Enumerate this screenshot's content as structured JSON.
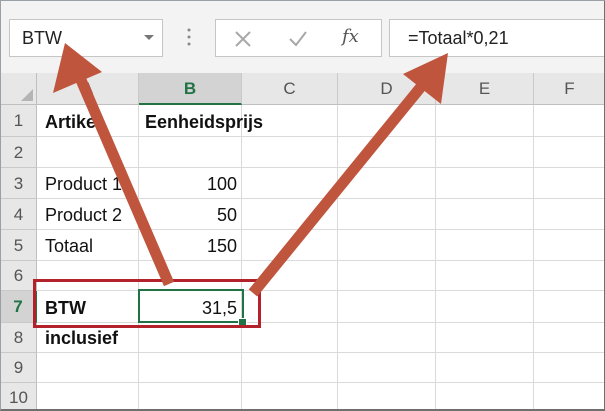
{
  "formula_bar": {
    "name_box": "BTW",
    "fx_label": "fx",
    "formula": "=Totaal*0,21"
  },
  "columns": [
    "A",
    "B",
    "C",
    "D",
    "E",
    "F"
  ],
  "selected_column": "B",
  "rows": [
    "1",
    "2",
    "3",
    "4",
    "5",
    "6",
    "7",
    "8",
    "9",
    "10"
  ],
  "selected_row": "7",
  "cells": {
    "A1": "Artikel",
    "B1": "Eenheidsprijs",
    "A3": "Product 1",
    "B3": "100",
    "A4": "Product 2",
    "B4": "50",
    "A5": "Totaal",
    "B5": "150",
    "A7": "BTW",
    "B7": "31,5",
    "A8": "inclusief"
  },
  "colors": {
    "accent_green": "#217346",
    "highlight_red": "#b3222a",
    "arrow": "#c0553e"
  },
  "icons": [
    "chevron-down-icon",
    "more-vert-icon",
    "cancel-x-icon",
    "enter-check-icon",
    "fx-icon"
  ]
}
